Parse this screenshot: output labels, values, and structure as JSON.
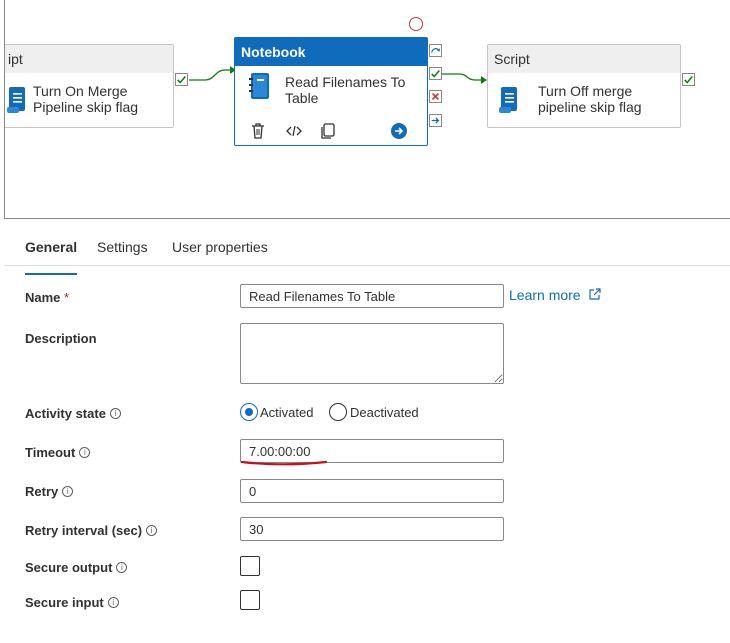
{
  "canvas": {
    "left_activity": {
      "type": "ipt",
      "title": "Turn On Merge Pipeline skip flag"
    },
    "middle_activity": {
      "type": "Notebook",
      "title": "Read Filenames To Table"
    },
    "right_activity": {
      "type": "Script",
      "title": "Turn Off merge pipeline skip flag"
    }
  },
  "tabs": [
    {
      "label": "General",
      "active": true
    },
    {
      "label": "Settings",
      "active": false
    },
    {
      "label": "User properties",
      "active": false
    }
  ],
  "form": {
    "name": {
      "label": "Name",
      "required_mark": "*",
      "value": "Read Filenames To Table"
    },
    "learn_more": "Learn more",
    "description": {
      "label": "Description",
      "value": ""
    },
    "activity_state": {
      "label": "Activity state",
      "options": [
        "Activated",
        "Deactivated"
      ],
      "selected": "Activated"
    },
    "timeout": {
      "label": "Timeout",
      "value": "7.00:00:00"
    },
    "retry": {
      "label": "Retry",
      "value": "0"
    },
    "retry_interval": {
      "label": "Retry interval (sec)",
      "value": "30"
    },
    "secure_output": {
      "label": "Secure output",
      "checked": false
    },
    "secure_input": {
      "label": "Secure input",
      "checked": false
    }
  },
  "colors": {
    "accent": "#0f6cbd",
    "success": "#107c10",
    "error": "#d13438",
    "annotation": "#c50f1f"
  }
}
